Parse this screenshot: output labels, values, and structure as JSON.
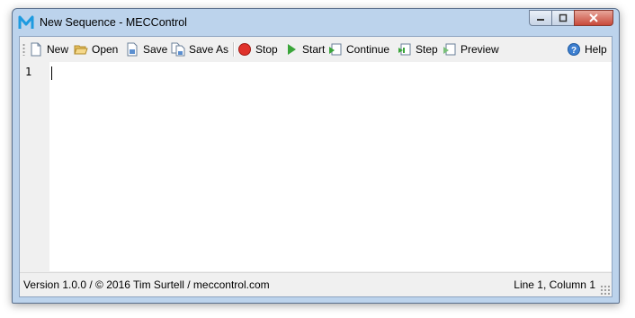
{
  "window": {
    "title": "New Sequence - MECControl",
    "logo_letter": "M"
  },
  "controls": {
    "minimize": "minimize",
    "maximize": "maximize",
    "close": "close"
  },
  "toolbar": {
    "new_label": "New",
    "open_label": "Open",
    "save_label": "Save",
    "save_as_label": "Save As",
    "stop_label": "Stop",
    "start_label": "Start",
    "continue_label": "Continue",
    "step_label": "Step",
    "preview_label": "Preview",
    "help_label": "Help"
  },
  "editor": {
    "line_numbers": [
      "1"
    ],
    "content": ""
  },
  "status": {
    "left": "Version 1.0.0 / © 2016 Tim Surtell / meccontrol.com",
    "right": "Line 1, Column 1"
  },
  "colors": {
    "accent": "#1e9be0",
    "stop": "#e0322b",
    "start": "#3aa53a",
    "close": "#c8493a"
  },
  "icons": [
    "new-file-icon",
    "open-folder-icon",
    "save-icon",
    "save-as-icon",
    "stop-icon",
    "start-icon",
    "continue-icon",
    "step-icon",
    "preview-icon",
    "help-icon"
  ]
}
